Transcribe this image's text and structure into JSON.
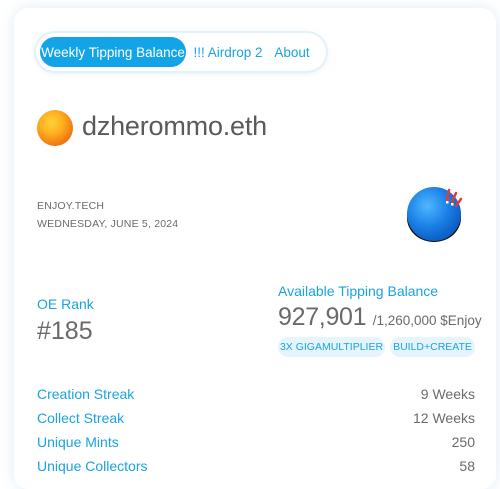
{
  "tabs": [
    {
      "label": "Weekly Tipping Balance",
      "active": true
    },
    {
      "label": "!!! Airdrop 2",
      "active": false
    },
    {
      "label": "About",
      "active": false
    }
  ],
  "profile": {
    "username": "dzherommo.eth",
    "avatar_icon": "orange-orb-avatar"
  },
  "meta": {
    "site": "ENJOY.TECH",
    "date": "WEDNESDAY, JUNE 5, 2024"
  },
  "mascot_icon": "blue-ball-mascot-icon",
  "rank": {
    "label": "OE Rank",
    "value": "#185"
  },
  "balance": {
    "label": "Available Tipping Balance",
    "value": "927,901",
    "total": "/1,260,000 $Enjoy",
    "badges": [
      "3X GIGAMULTIPLIER",
      "BUILD+CREATE"
    ]
  },
  "stats": [
    {
      "label": "Creation Streak",
      "value": "9 Weeks"
    },
    {
      "label": "Collect Streak",
      "value": "12 Weeks"
    },
    {
      "label": "Unique Mints",
      "value": "250"
    },
    {
      "label": "Unique Collectors",
      "value": "58"
    }
  ],
  "colors": {
    "accent": "#13a4e7",
    "link": "#1aa3e0",
    "text": "#6a6a6a",
    "pill_bg": "#e6f4fd"
  }
}
